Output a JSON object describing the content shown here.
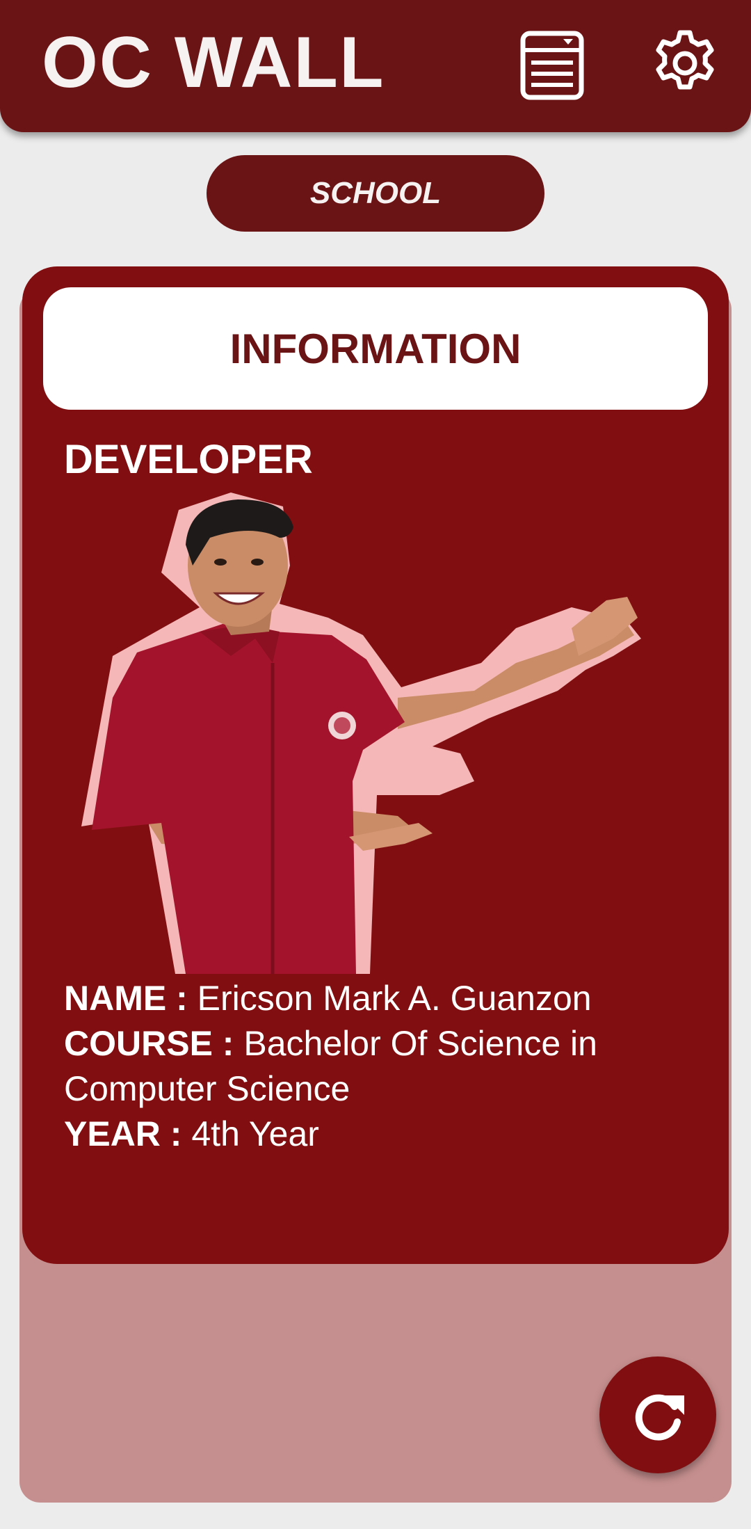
{
  "header": {
    "title": "OC WALL",
    "list_icon": "list-icon",
    "settings_icon": "gear-icon"
  },
  "category": {
    "label": "SCHOOL"
  },
  "info_card": {
    "heading": "INFORMATION",
    "section_title": "DEVELOPER",
    "photo_icon": "developer-photo",
    "details": {
      "name_label": "NAME :",
      "name_value": "Ericson Mark A. Guanzon",
      "course_label": "COURSE :",
      "course_value": "Bachelor Of Science in Computer Science",
      "year_label": "YEAR :",
      "year_value": "4th Year"
    }
  },
  "fab": {
    "icon": "refresh-icon"
  },
  "colors": {
    "primary": "#6b1416",
    "card": "#810f11",
    "panel": "#c68f8f",
    "background": "#ececec",
    "shirt": "#a3142c",
    "outline": "#f5b7b7"
  }
}
